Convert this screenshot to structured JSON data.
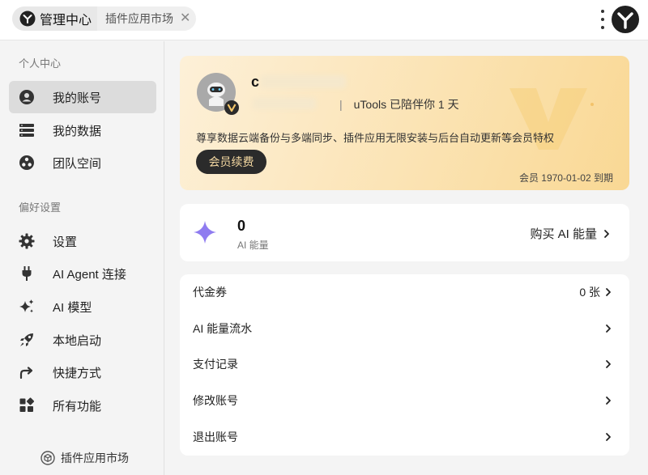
{
  "tabs": {
    "home_label": "管理中心",
    "market_label": "插件应用市场",
    "close_glyph": "✕"
  },
  "sidebar": {
    "section_personal": "个人中心",
    "section_prefs": "偏好设置",
    "items": [
      {
        "label": "我的账号",
        "icon": "user-icon",
        "active": true
      },
      {
        "label": "我的数据",
        "icon": "data-icon",
        "active": false
      },
      {
        "label": "团队空间",
        "icon": "team-icon",
        "active": false
      },
      {
        "label": "设置",
        "icon": "gear-icon",
        "active": false
      },
      {
        "label": "AI Agent 连接",
        "icon": "plug-icon",
        "active": false
      },
      {
        "label": "AI 模型",
        "icon": "sparkle-icon",
        "active": false
      },
      {
        "label": "本地启动",
        "icon": "rocket-icon",
        "active": false
      },
      {
        "label": "快捷方式",
        "icon": "shortcut-arrow-icon",
        "active": false
      },
      {
        "label": "所有功能",
        "icon": "apps-grid-icon",
        "active": false
      }
    ],
    "footer_label": "插件应用市场"
  },
  "member": {
    "name_initial": "c",
    "since_text": "uTools 已陪伴你 1 天",
    "perks": "尊享数据云端备份与多端同步、插件应用无限安装与后台自动更新等会员特权",
    "renew_label": "会员续费",
    "expiry": "会员 1970-01-02 到期"
  },
  "ai": {
    "count": "0",
    "label": "AI 能量",
    "buy_label": "购买 AI 能量"
  },
  "list": {
    "rows": [
      {
        "label": "代金券",
        "value": "0 张"
      },
      {
        "label": "AI 能量流水",
        "value": ""
      },
      {
        "label": "支付记录",
        "value": ""
      },
      {
        "label": "修改账号",
        "value": ""
      },
      {
        "label": "退出账号",
        "value": ""
      }
    ]
  },
  "colors": {
    "accent_purple": "#8f7cf0",
    "gold": "#f5c76a",
    "dark_button": "#2b2b2b"
  }
}
